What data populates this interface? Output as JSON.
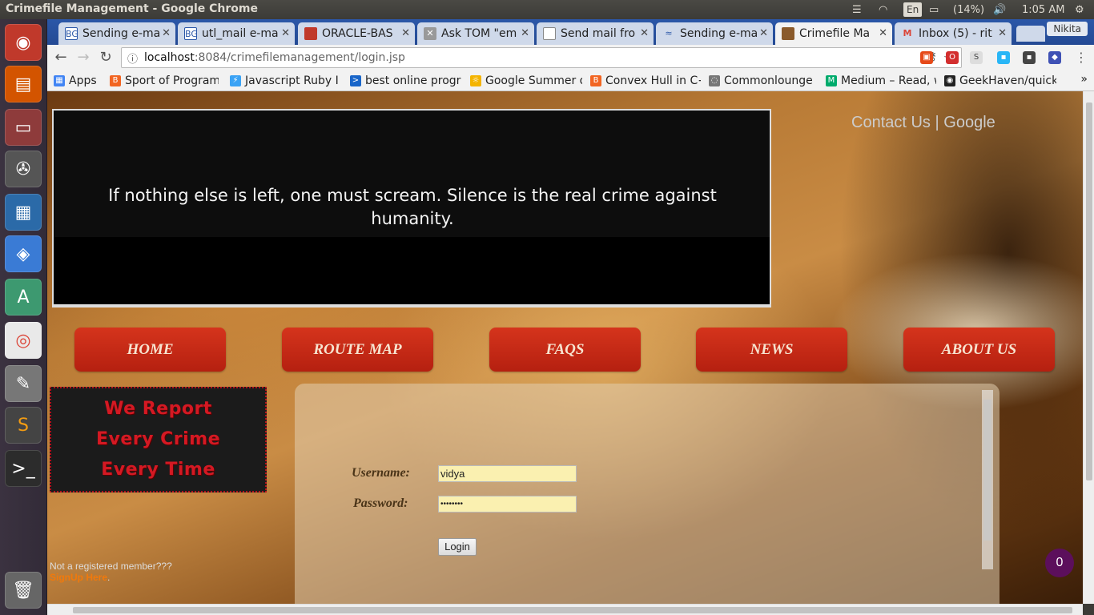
{
  "os": {
    "window_title": "Crimefile Management - Google Chrome",
    "battery": "(14%)",
    "keyboard": "En",
    "time": "1:05 AM"
  },
  "browser": {
    "profile": "Nikita",
    "tabs": [
      {
        "title": "Sending e-ma",
        "icon": "bg-favicon"
      },
      {
        "title": "utl_mail e-ma",
        "icon": "bg-favicon"
      },
      {
        "title": "ORACLE-BAS",
        "icon": "oracle-favicon"
      },
      {
        "title": "Ask TOM \"em",
        "icon": "asktom-favicon"
      },
      {
        "title": "Send mail fro",
        "icon": "page-favicon"
      },
      {
        "title": "Sending e-ma",
        "icon": "wave-favicon"
      },
      {
        "title": "Crimefile Ma",
        "icon": "crimefile-favicon"
      },
      {
        "title": "Inbox (5) - rit",
        "icon": "gmail-favicon"
      }
    ],
    "url_host": "localhost",
    "url_rest": ":8084/crimefilemanagement/login.jsp",
    "bookmarks": [
      {
        "label": "Apps",
        "color": "#4285f4"
      },
      {
        "label": "Sport of Program",
        "color": "#f26522"
      },
      {
        "label": "Javascript Ruby I",
        "color": "#3ba3f5"
      },
      {
        "label": "best online progr",
        "color": "#1a66c9"
      },
      {
        "label": "Google Summer o",
        "color": "#f4b400"
      },
      {
        "label": "Convex Hull in C+",
        "color": "#f26522"
      },
      {
        "label": "Commonlounge",
        "color": "#777777"
      },
      {
        "label": "Medium – Read, w",
        "color": "#00ab6c"
      },
      {
        "label": "GeekHaven/quick",
        "color": "#222222"
      }
    ]
  },
  "page": {
    "quote": "If nothing else is left, one must scream. Silence is the real crime against humanity.",
    "contact_link": "Contact Us",
    "separator": "|",
    "google_link": "Google",
    "nav": [
      "HOME",
      "ROUTE MAP",
      "FAQS",
      "NEWS",
      "ABOUT US"
    ],
    "slogan": [
      "We Report",
      "Every Crime",
      "Every Time"
    ],
    "signup_prompt": "Not a registered member???",
    "signup_link": "SignUp Here",
    "signup_suffix": ".",
    "login": {
      "username_label": "Username:",
      "username_value": "vidya",
      "password_label": "Password:",
      "password_value": "••••••••",
      "button": "Login"
    },
    "chat_count": "0"
  }
}
